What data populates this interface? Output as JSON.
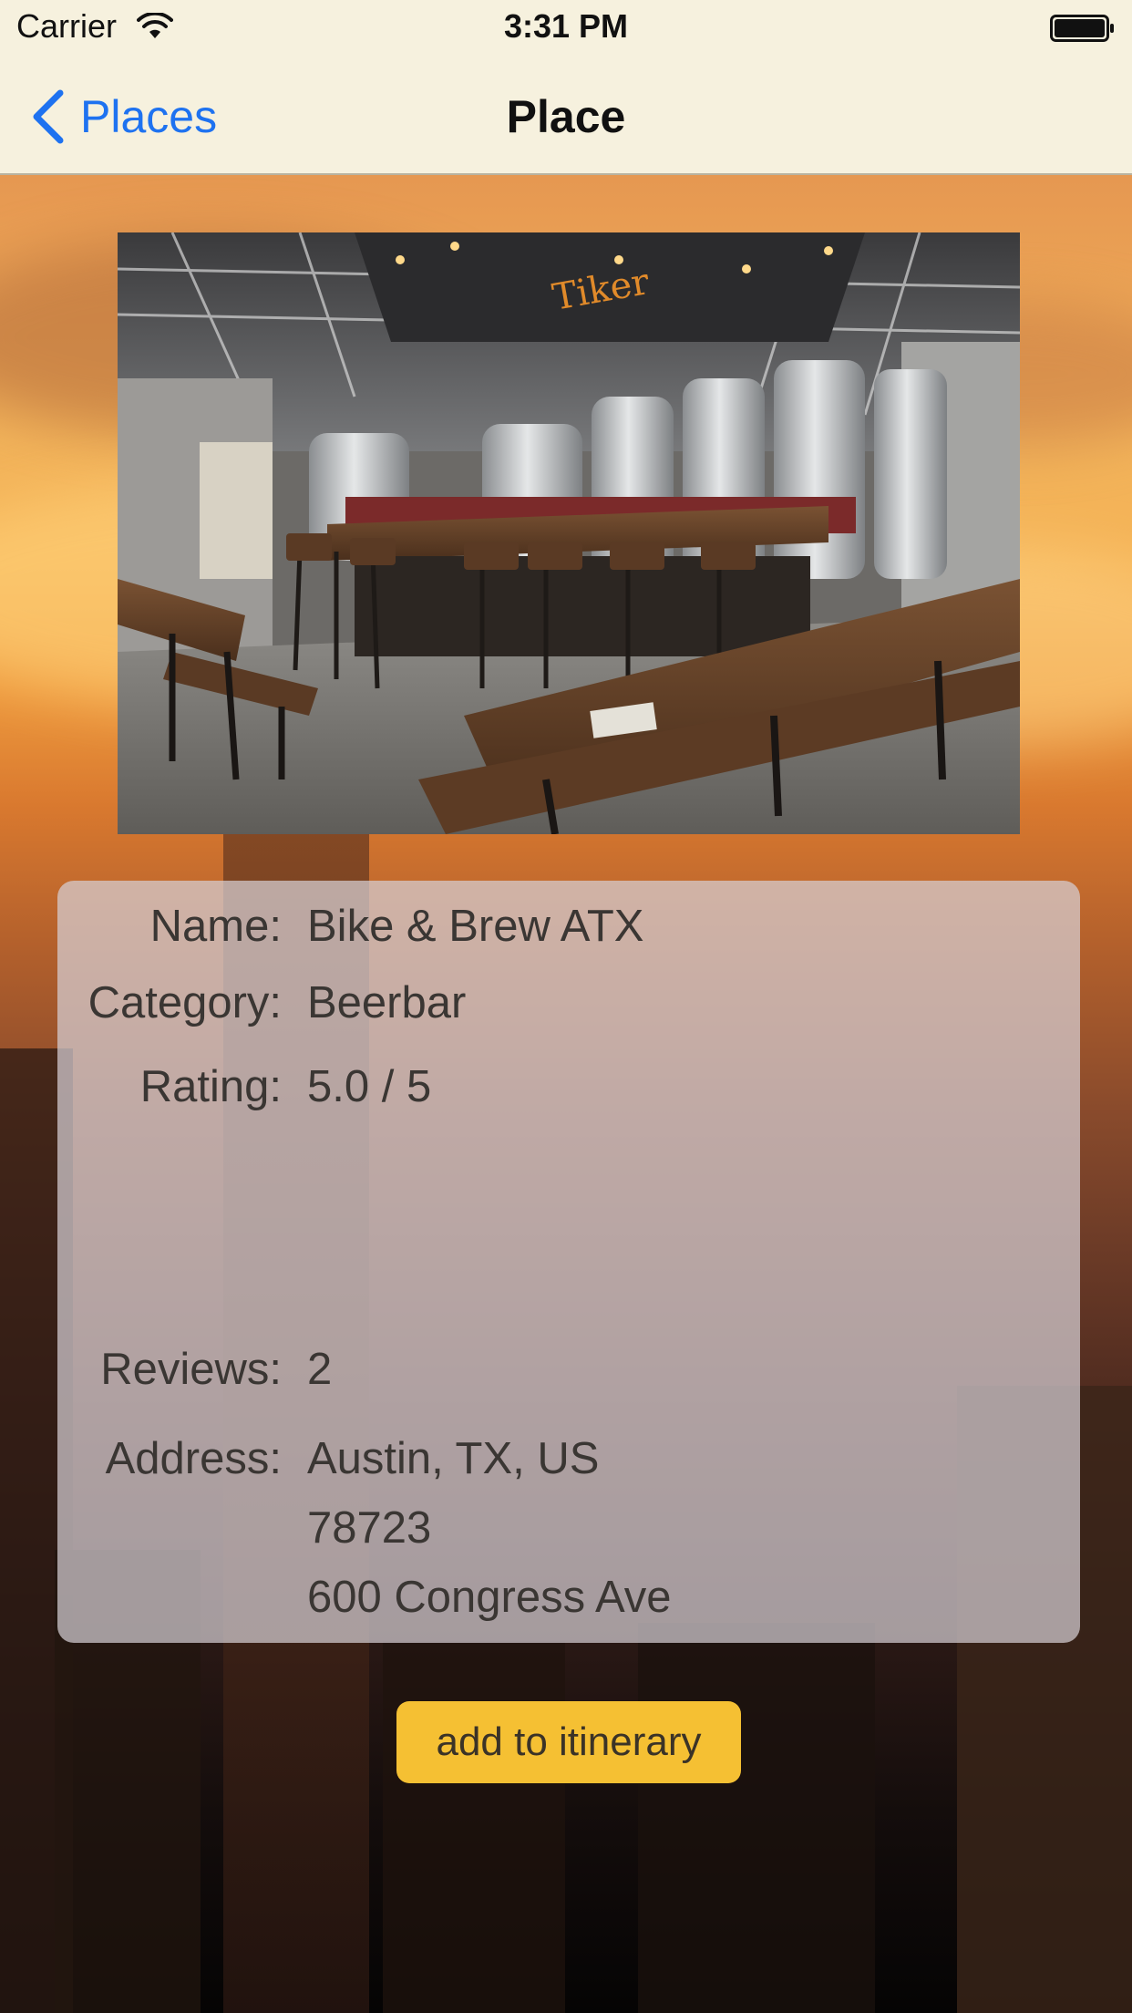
{
  "status_bar": {
    "carrier": "Carrier",
    "time": "3:31 PM",
    "icons": [
      "wifi-icon",
      "battery-icon"
    ]
  },
  "nav_bar": {
    "back_label": "Places",
    "title": "Place",
    "back_icon": "chevron-left-icon"
  },
  "photo": {
    "description_icon": "place-photo"
  },
  "details": {
    "name_label": "Name:",
    "name_value": "Bike & Brew ATX",
    "category_label": "Category:",
    "category_value": "Beerbar",
    "rating_label": "Rating:",
    "rating_value": "5.0 / 5",
    "reviews_label": "Reviews:",
    "reviews_value": "2",
    "address_label": "Address:",
    "address_lines": [
      "Austin, TX, US",
      "78723",
      "600 Congress Ave"
    ]
  },
  "actions": {
    "add_label": "add to itinerary"
  },
  "colors": {
    "nav_background": "#f6f1de",
    "link_blue": "#1e72f0",
    "button_yellow": "#f5c033"
  }
}
